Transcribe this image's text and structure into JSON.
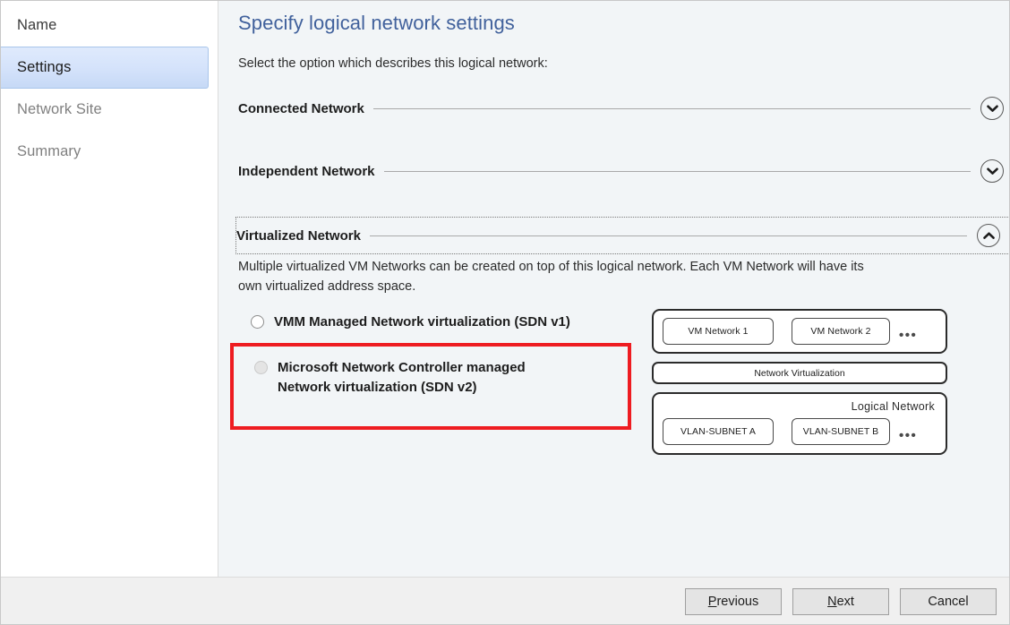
{
  "window": {
    "title": "Specify logical network settings"
  },
  "sidebar": {
    "items": [
      {
        "label": "Name",
        "state": "done"
      },
      {
        "label": "Settings",
        "state": "active"
      },
      {
        "label": "Network Site",
        "state": "pending"
      },
      {
        "label": "Summary",
        "state": "pending"
      }
    ]
  },
  "main": {
    "title": "Specify logical network settings",
    "subtitle": "Select the option which describes this logical network:",
    "sections": [
      {
        "title": "Connected Network",
        "expanded": false,
        "chevron": "chevron-down-icon"
      },
      {
        "title": "Independent Network",
        "expanded": false,
        "chevron": "chevron-down-icon"
      },
      {
        "title": "Virtualized Network",
        "expanded": true,
        "chevron": "chevron-up-icon",
        "focused": true
      }
    ],
    "virtualized": {
      "description": "Multiple virtualized VM Networks can be created on top of this logical network. Each VM Network will have its own virtualized address space.",
      "options": [
        {
          "label": "VMM Managed Network virtualization (SDN v1)",
          "selected": false,
          "disabled": false,
          "highlighted": false
        },
        {
          "label": "Microsoft Network Controller managed Network virtualization (SDN v2)",
          "selected": false,
          "disabled": true,
          "highlighted": true
        }
      ]
    },
    "diagram": {
      "vm_networks": [
        "VM Network 1",
        "VM Network 2"
      ],
      "vm_networks_more": "•••",
      "network_virtualization_label": "Network Virtualization",
      "logical_network_label": "Logical  Network",
      "vlan_subnets": [
        "VLAN-SUBNET A",
        "VLAN-SUBNET B"
      ],
      "vlan_subnets_more": "•••"
    }
  },
  "footer": {
    "buttons": [
      {
        "name": "previous-button",
        "accel": "P",
        "rest": "revious"
      },
      {
        "name": "next-button",
        "accel": "N",
        "rest": "ext"
      },
      {
        "name": "cancel-button",
        "accel": "",
        "rest": "Cancel"
      }
    ]
  },
  "colors": {
    "title_blue": "#41619c",
    "highlight_red": "#ee1c21",
    "nav_active_bg": "#d5e3fb",
    "content_bg": "#f2f5f7",
    "footer_bg": "#f0f0f0"
  }
}
